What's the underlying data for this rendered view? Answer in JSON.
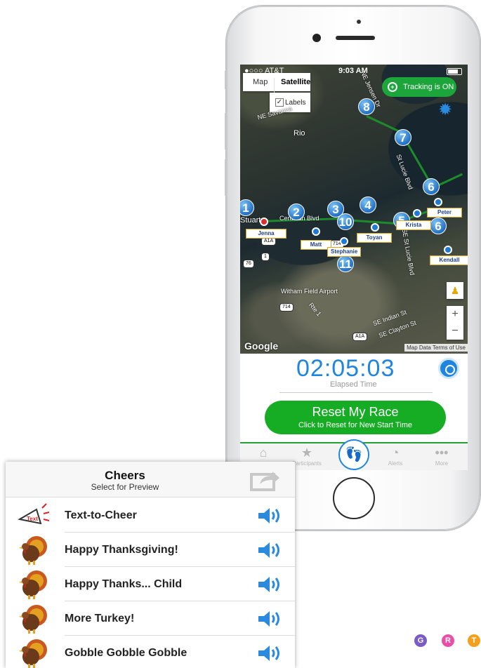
{
  "status": {
    "carrier": "●○○○ AT&T",
    "time": "9:03 AM"
  },
  "map": {
    "type_map": "Map",
    "type_satellite": "Satellite",
    "labels": "Labels",
    "tracking": "Tracking is ON",
    "google": "Google",
    "attribution": "Map Data  Terms of Use",
    "places": [
      "Rio",
      "Stuart",
      "Witham Field Airport",
      "St Lucie Blvd",
      "SE St Lucie Blvd",
      "Rte 1",
      "SE Indian St",
      "SE Clayton St",
      "NE Savanna",
      "Cerulean Blvd",
      "NE Jensen Dr"
    ],
    "roads": [
      "A1A",
      "1",
      "76",
      "714",
      "A1A",
      "714"
    ],
    "markers": [
      "1",
      "2",
      "3",
      "4",
      "5",
      "6",
      "6",
      "7",
      "8",
      "10",
      "11"
    ],
    "participants": [
      "Jenna",
      "Matt",
      "Stephanie",
      "Toyan",
      "Krista",
      "Peter",
      "Kendall"
    ]
  },
  "timer": {
    "value": "02:05:03",
    "label": "Elapsed Time"
  },
  "reset": {
    "title": "Reset My Race",
    "subtitle": "Click to Reset for New Start Time"
  },
  "tabs": [
    {
      "label": "Home",
      "icon": "home-icon"
    },
    {
      "label": "Participants",
      "icon": "star-add-icon"
    },
    {
      "label": "Alerts",
      "icon": "alerts-icon"
    },
    {
      "label": "More",
      "icon": "more-icon"
    }
  ],
  "cheers": {
    "title": "Cheers",
    "subtitle": "Select for Preview",
    "items": [
      "Text-to-Cheer",
      "Happy Thanksgiving!",
      "Happy Thanks... Child",
      "More Turkey!",
      "Gobble Gobble Gobble"
    ]
  },
  "badges": [
    {
      "letter": "G",
      "color": "#7b5cc4"
    },
    {
      "letter": "R",
      "color": "#e84fa6"
    },
    {
      "letter": "T",
      "color": "#f2a01e"
    }
  ],
  "colors": {
    "accent_blue": "#1f86e0",
    "accent_green": "#16ad25"
  }
}
